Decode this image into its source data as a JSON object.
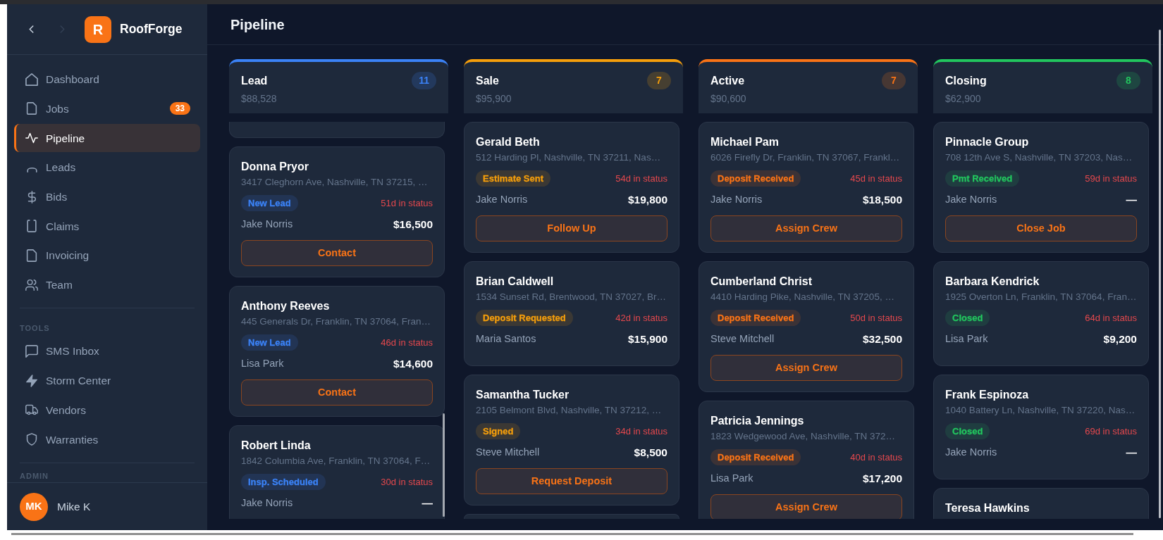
{
  "sidebar": {
    "nav_arrows": [
      {
        "kind": "back",
        "disabled": false
      },
      {
        "kind": "forward",
        "disabled": true
      }
    ],
    "brand": {
      "initial": "R",
      "name": "RoofForge"
    },
    "sections": [
      {
        "items": [
          {
            "label": "Dashboard",
            "selected": false
          },
          {
            "label": "Jobs",
            "selected": false,
            "badge": "33"
          },
          {
            "label": "Pipeline",
            "selected": true
          },
          {
            "label": "Leads",
            "selected": false
          },
          {
            "label": "Bids",
            "selected": false
          },
          {
            "label": "Claims",
            "selected": false
          },
          {
            "label": "Invoicing",
            "selected": false
          },
          {
            "label": "Team",
            "selected": false
          }
        ]
      },
      {
        "heading": "TOOLS",
        "items": [
          {
            "label": "SMS Inbox",
            "selected": false
          },
          {
            "label": "Storm Center",
            "selected": false
          },
          {
            "label": "Vendors",
            "selected": false
          },
          {
            "label": "Warranties",
            "selected": false
          }
        ]
      },
      {
        "heading": "ADMIN"
      }
    ],
    "user": {
      "initials": "MK",
      "name": "Mike K"
    }
  },
  "page_title": "Pipeline",
  "columns": [
    {
      "title": "Lead",
      "total": "$88,528",
      "count": "11",
      "color": "#3b82f6",
      "cards": [
        {
          "kind": "clipped"
        },
        {
          "kind": "job",
          "name": "Donna Pryor",
          "address": "3417 Cleghorn Ave, Nashville, TN 37215, …",
          "status": {
            "label": "New Lead",
            "color": "#3b82f6"
          },
          "days": "51d in status",
          "assignee": "Jake Norris",
          "amount": "$16,500",
          "action": "Contact"
        },
        {
          "kind": "job",
          "name": "Anthony Reeves",
          "address": "445 Generals Dr, Franklin, TN 37064, Fran…",
          "status": {
            "label": "New Lead",
            "color": "#3b82f6"
          },
          "days": "46d in status",
          "assignee": "Lisa Park",
          "amount": "$14,600",
          "action": "Contact"
        },
        {
          "kind": "job",
          "name": "Robert Linda",
          "address": "1842 Columbia Ave, Franklin, TN 37064, F…",
          "status": {
            "label": "Insp. Scheduled",
            "color": "#3b82f6"
          },
          "days": "30d in status",
          "assignee": "Jake Norris",
          "amount": "—"
        }
      ]
    },
    {
      "title": "Sale",
      "total": "$95,900",
      "count": "7",
      "color": "#f59e0b",
      "cards": [
        {
          "kind": "job",
          "name": "Gerald Beth",
          "address": "512 Harding Pl, Nashville, TN 37211, Nas…",
          "status": {
            "label": "Estimate Sent",
            "color": "#f59e0b"
          },
          "days": "54d in status",
          "assignee": "Jake Norris",
          "amount": "$19,800",
          "action": "Follow Up"
        },
        {
          "kind": "job",
          "name": "Brian Caldwell",
          "address": "1534 Sunset Rd, Brentwood, TN 37027, Br…",
          "status": {
            "label": "Deposit Requested",
            "color": "#f59e0b"
          },
          "days": "42d in status",
          "assignee": "Maria Santos",
          "amount": "$15,900"
        },
        {
          "kind": "job",
          "name": "Samantha Tucker",
          "address": "2105 Belmont Blvd, Nashville, TN 37212, …",
          "status": {
            "label": "Signed",
            "color": "#f59e0b"
          },
          "days": "34d in status",
          "assignee": "Steve Mitchell",
          "amount": "$8,500",
          "action": "Request Deposit"
        },
        {
          "kind": "clipped"
        }
      ]
    },
    {
      "title": "Active",
      "total": "$90,600",
      "count": "7",
      "color": "#f97316",
      "cards": [
        {
          "kind": "job",
          "name": "Michael Pam",
          "address": "6026 Firefly Dr, Franklin, TN 37067, Frankl…",
          "status": {
            "label": "Deposit Received",
            "color": "#f97316"
          },
          "days": "45d in status",
          "assignee": "Jake Norris",
          "amount": "$18,500",
          "action": "Assign Crew"
        },
        {
          "kind": "job",
          "name": "Cumberland Christ",
          "address": "4410 Harding Pike, Nashville, TN 37205, …",
          "status": {
            "label": "Deposit Received",
            "color": "#f97316"
          },
          "days": "50d in status",
          "assignee": "Steve Mitchell",
          "amount": "$32,500",
          "action": "Assign Crew"
        },
        {
          "kind": "job",
          "name": "Patricia Jennings",
          "address": "1823 Wedgewood Ave, Nashville, TN 372…",
          "status": {
            "label": "Deposit Received",
            "color": "#f97316"
          },
          "days": "40d in status",
          "assignee": "Lisa Park",
          "amount": "$17,200",
          "action": "Assign Crew"
        }
      ]
    },
    {
      "title": "Closing",
      "total": "$62,900",
      "count": "8",
      "color": "#22c55e",
      "cards": [
        {
          "kind": "job",
          "name": "Pinnacle Group",
          "address": "708 12th Ave S, Nashville, TN 37203, Nas…",
          "status": {
            "label": "Pmt Received",
            "color": "#22c55e"
          },
          "days": "59d in status",
          "assignee": "Jake Norris",
          "amount": "—",
          "action": "Close Job"
        },
        {
          "kind": "job",
          "name": "Barbara Kendrick",
          "address": "1925 Overton Ln, Franklin, TN 37064, Fran…",
          "status": {
            "label": "Closed",
            "color": "#22c55e"
          },
          "days": "64d in status",
          "assignee": "Lisa Park",
          "amount": "$9,200"
        },
        {
          "kind": "job",
          "name": "Frank Espinoza",
          "address": "1040 Battery Ln, Nashville, TN 37220, Nas…",
          "status": {
            "label": "Closed",
            "color": "#22c55e"
          },
          "days": "69d in status",
          "assignee": "Jake Norris",
          "amount": "—"
        },
        {
          "kind": "job",
          "name": "Teresa Hawkins"
        }
      ]
    }
  ]
}
